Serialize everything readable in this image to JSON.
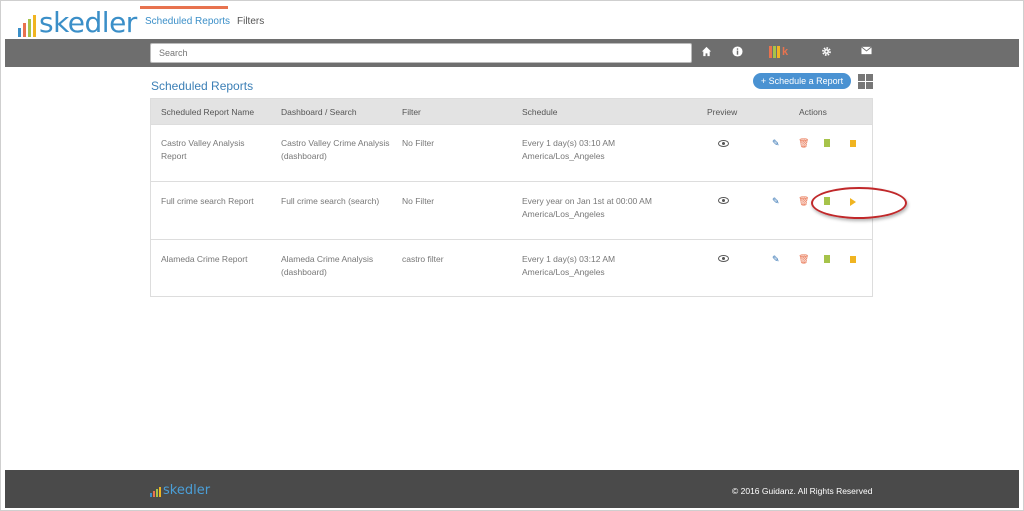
{
  "brand": {
    "name": "skedler",
    "bar_colors": [
      "#3b8fc8",
      "#e8734f",
      "#a6c34a",
      "#f0b421"
    ]
  },
  "nav": {
    "tabs": [
      {
        "label": "Scheduled Reports"
      },
      {
        "label": "Filters"
      }
    ]
  },
  "search": {
    "placeholder": "Search"
  },
  "toolbar_icons": [
    "home-icon",
    "info-icon",
    "kibana-icon",
    "gear-icon",
    "mail-icon"
  ],
  "page": {
    "title": "Scheduled Reports",
    "schedule_button_label": "+ Schedule a Report"
  },
  "table": {
    "headers": [
      "Scheduled Report Name",
      "Dashboard / Search",
      "Filter",
      "Schedule",
      "Preview",
      "Actions"
    ],
    "rows": [
      {
        "name": "Castro Valley Analysis Report",
        "dashboard": "Castro Valley Crime Analysis (dashboard)",
        "filter": "No Filter",
        "schedule": "Every 1 day(s) 03:10 AM America/Los_Angeles"
      },
      {
        "name": "Full crime search Report",
        "dashboard": "Full crime search (search)",
        "filter": "No Filter",
        "schedule": "Every year on Jan 1st at 00:00 AM America/Los_Angeles"
      },
      {
        "name": "Alameda Crime Report",
        "dashboard": "Alameda Crime Analysis (dashboard)",
        "filter": "castro filter",
        "schedule": "Every 1 day(s) 03:12 AM America/Los_Angeles"
      }
    ],
    "row_actions": [
      "preview-icon",
      "edit-icon",
      "delete-icon",
      "file-icon",
      "run-icon",
      "pause-icon"
    ]
  },
  "footer": {
    "brand": "skedler",
    "copyright": "© 2016 Guidanz. All Rights Reserved"
  },
  "colors": {
    "accent": "#3b8fc8",
    "orange": "#e8734f",
    "green": "#a6c34a",
    "yellow": "#f0b421",
    "highlight": "#c0282a"
  }
}
